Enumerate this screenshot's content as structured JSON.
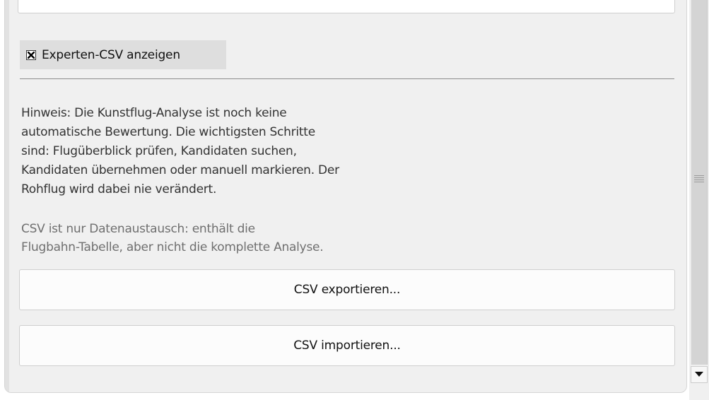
{
  "expert_csv": {
    "label": "Experten-CSV anzeigen",
    "checked": true
  },
  "hint_lines": [
    "Hinweis: Die Kunstflug-Analyse ist noch keine",
    "automatische Bewertung. Die wichtigsten Schritte",
    "sind: Flugüberblick prüfen, Kandidaten suchen,",
    "Kandidaten übernehmen oder manuell markieren. Der",
    "Rohflug wird dabei nie verändert."
  ],
  "note_lines": [
    "CSV ist nur Datenaustausch: enthält die",
    "Flugbahn-Tabelle, aber nicht die komplette Analyse."
  ],
  "buttons": {
    "export": "CSV exportieren...",
    "import": "CSV importieren..."
  },
  "icons": {
    "checkbox": "x-mark-icon",
    "scroll_grip": "grip-lines-icon",
    "scroll_down": "triangle-down-icon"
  },
  "colors": {
    "panel_bg": "#f0f0f0",
    "checkbox_row_bg": "#dedede",
    "note_text": "#6f6f6f"
  }
}
